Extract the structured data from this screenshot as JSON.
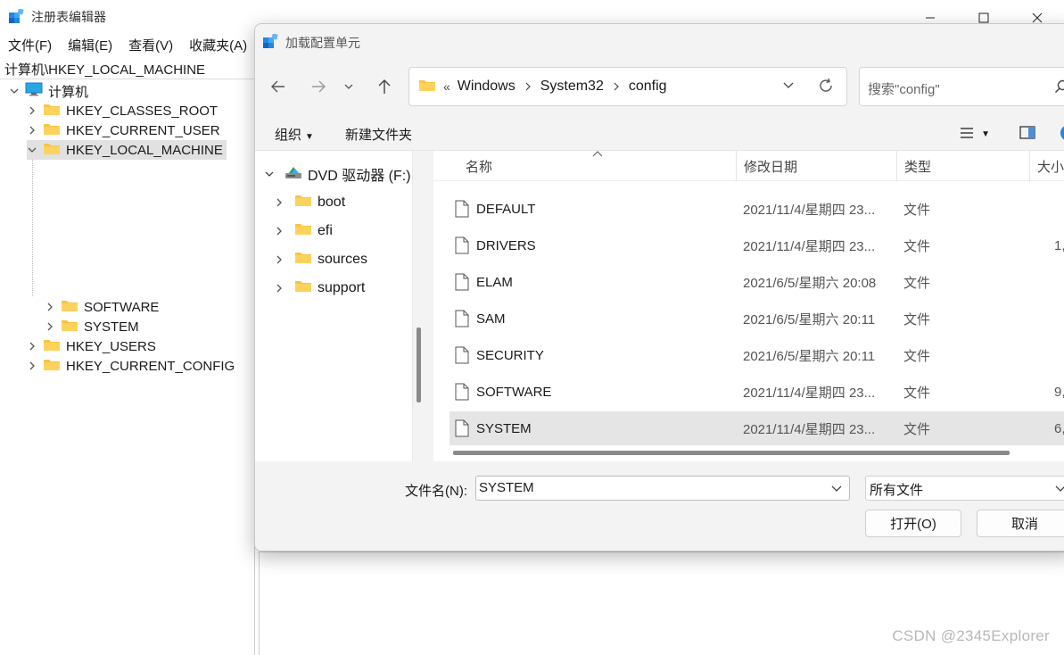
{
  "registry": {
    "title": "注册表编辑器",
    "menu": [
      "文件(F)",
      "编辑(E)",
      "查看(V)",
      "收藏夹(A)"
    ],
    "address": "计算机\\HKEY_LOCAL_MACHINE",
    "tree": {
      "root": "计算机",
      "classes_root": "HKEY_CLASSES_ROOT",
      "current_user": "HKEY_CURRENT_USER",
      "local_machine": "HKEY_LOCAL_MACHINE",
      "software": "SOFTWARE",
      "system": "SYSTEM",
      "users": "HKEY_USERS",
      "current_config": "HKEY_CURRENT_CONFIG"
    }
  },
  "dialog": {
    "title": "加载配置单元",
    "breadcrumb": {
      "overflow": "«",
      "items": [
        "Windows",
        "System32",
        "config"
      ]
    },
    "search_placeholder": "搜索\"config\"",
    "toolbar": {
      "organize": "组织",
      "new_folder": "新建文件夹"
    },
    "nav": {
      "drive": "DVD 驱动器 (F:) C",
      "folders": [
        "boot",
        "efi",
        "sources",
        "support"
      ]
    },
    "columns": {
      "name": "名称",
      "date": "修改日期",
      "type": "类型",
      "size": "大小"
    },
    "files": [
      {
        "name": "DEFAULT",
        "date": "2021/11/4/星期四 23...",
        "type": "文件",
        "size": ""
      },
      {
        "name": "DRIVERS",
        "date": "2021/11/4/星期四 23...",
        "type": "文件",
        "size": "1,"
      },
      {
        "name": "ELAM",
        "date": "2021/6/5/星期六 20:08",
        "type": "文件",
        "size": ""
      },
      {
        "name": "SAM",
        "date": "2021/6/5/星期六 20:11",
        "type": "文件",
        "size": ""
      },
      {
        "name": "SECURITY",
        "date": "2021/6/5/星期六 20:11",
        "type": "文件",
        "size": ""
      },
      {
        "name": "SOFTWARE",
        "date": "2021/11/4/星期四 23...",
        "type": "文件",
        "size": "9,"
      },
      {
        "name": "SYSTEM",
        "date": "2021/11/4/星期四 23...",
        "type": "文件",
        "size": "6,"
      }
    ],
    "selected_file": "SYSTEM",
    "filename_label": "文件名(N):",
    "filename_value": "SYSTEM",
    "filter_value": "所有文件",
    "open_button": "打开(O)",
    "cancel_button": "取消"
  },
  "watermark": "CSDN @2345Explorer",
  "colors": {
    "folder": "#F8C443",
    "selection": "#E5E5E5",
    "dialog_bg": "#F3F3F3",
    "regedit_icon": "#1E88E5"
  }
}
